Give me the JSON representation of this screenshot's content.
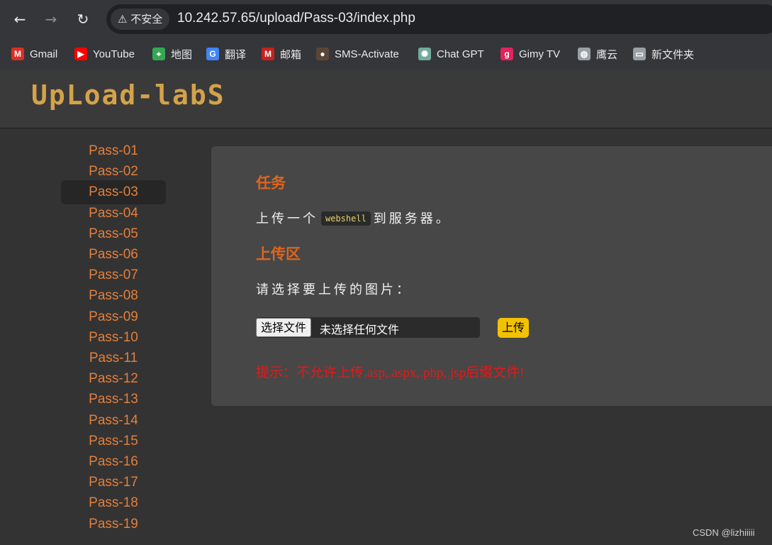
{
  "browser": {
    "back_icon": "←",
    "forward_icon": "→",
    "reload_icon": "↻",
    "security_label": "不安全",
    "url": "10.242.57.65/upload/Pass-03/index.php"
  },
  "bookmarks": [
    {
      "label": "Gmail",
      "icon": "gmail-icon",
      "glyph": "M",
      "color": "#d93025"
    },
    {
      "label": "YouTube",
      "icon": "youtube-icon",
      "glyph": "▶",
      "color": "#ff0000"
    },
    {
      "label": "地图",
      "icon": "maps-icon",
      "glyph": "⌖",
      "color": "#34a853"
    },
    {
      "label": "翻译",
      "icon": "translate-icon",
      "glyph": "G",
      "color": "#4285f4"
    },
    {
      "label": "邮箱",
      "icon": "mail-icon",
      "glyph": "M",
      "color": "#c5221f"
    },
    {
      "label": "SMS-Activate",
      "icon": "sms-activate-icon",
      "glyph": "●",
      "color": "#5a4636"
    },
    {
      "label": "Chat GPT",
      "icon": "chatgpt-icon",
      "glyph": "✺",
      "color": "#74aa9c"
    },
    {
      "label": "Gimy TV",
      "icon": "gimy-icon",
      "glyph": "g",
      "color": "#e0245e"
    },
    {
      "label": "鹰云",
      "icon": "globe-icon",
      "glyph": "◍",
      "color": "#9aa0a6"
    },
    {
      "label": "新文件夹",
      "icon": "folder-icon",
      "glyph": "▭",
      "color": "#9aa0a6"
    }
  ],
  "site": {
    "logo_text": "UpLoad-labS"
  },
  "sidebar": {
    "items": [
      "Pass-01",
      "Pass-02",
      "Pass-03",
      "Pass-04",
      "Pass-05",
      "Pass-06",
      "Pass-07",
      "Pass-08",
      "Pass-09",
      "Pass-10",
      "Pass-11",
      "Pass-12",
      "Pass-13",
      "Pass-14",
      "Pass-15",
      "Pass-16",
      "Pass-17",
      "Pass-18",
      "Pass-19"
    ],
    "active": "Pass-03"
  },
  "main": {
    "task_heading": "任务",
    "task_prefix": "上传一个",
    "task_code": "webshell",
    "task_suffix": "到服务器。",
    "upload_heading": "上传区",
    "upload_prompt": "请选择要上传的图片：",
    "file_button": "选择文件",
    "file_status": "未选择任何文件",
    "upload_button": "上传",
    "hint": "提示：不允许上传.asp,.aspx,.php,.jsp后缀文件!"
  },
  "watermark": "CSDN @lizhiiiii",
  "colors": {
    "accent_orange": "#e0651d",
    "link_orange": "#e47f3b",
    "hint_red": "#e01b1b",
    "upload_yellow": "#f2c200"
  }
}
